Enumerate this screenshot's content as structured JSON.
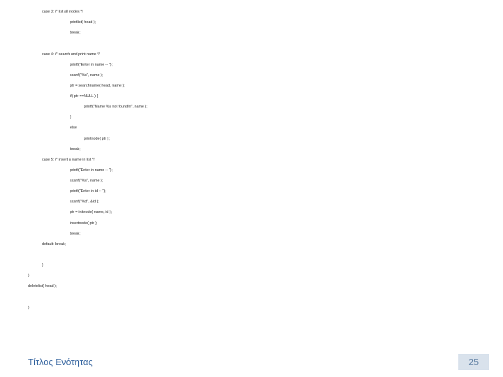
{
  "code": {
    "lines": [
      {
        "indent": 1,
        "text": "case 3: /* list all nodes */"
      },
      {
        "indent": 3,
        "text": "printlist( head );"
      },
      {
        "indent": 3,
        "text": "break;"
      },
      {
        "indent": 3,
        "text": ""
      },
      {
        "indent": 1,
        "text": "case 4: /* search and print name */"
      },
      {
        "indent": 3,
        "text": "printf(\"Enter in name -- \");"
      },
      {
        "indent": 3,
        "text": "scanf(\"%s\", name );"
      },
      {
        "indent": 3,
        "text": "ptr = searchname( head, name );"
      },
      {
        "indent": 3,
        "text": "if( ptr ==NULL ) {"
      },
      {
        "indent": 4,
        "text": "printf(\"Name %s not found\\n\", name );"
      },
      {
        "indent": 3,
        "text": "}"
      },
      {
        "indent": 3,
        "text": "else"
      },
      {
        "indent": 4,
        "text": "printnode( ptr );"
      },
      {
        "indent": 3,
        "text": "break;"
      },
      {
        "indent": 1,
        "text": "case 5: /* insert a name in list */"
      },
      {
        "indent": 3,
        "text": "printf(\"Enter in name -- \");"
      },
      {
        "indent": 3,
        "text": "scanf(\"%s\", name );"
      },
      {
        "indent": 3,
        "text": "printf(\"Enter in id -- \");"
      },
      {
        "indent": 3,
        "text": "scanf(\"%d\", &id );"
      },
      {
        "indent": 3,
        "text": "ptr = initnode( name, id );"
      },
      {
        "indent": 3,
        "text": "insertnode( ptr );"
      },
      {
        "indent": 3,
        "text": "break;"
      },
      {
        "indent": 1,
        "text": "default: break;"
      },
      {
        "indent": 1,
        "text": ""
      },
      {
        "indent": 1,
        "text": "}"
      },
      {
        "indent": 0,
        "text": "}"
      },
      {
        "indent": 0,
        "text": "deletelist( head );"
      },
      {
        "indent": 0,
        "text": ""
      },
      {
        "indent": 0,
        "text": "}"
      }
    ]
  },
  "footer": {
    "title": "Τίτλος Ενότητας",
    "page": "25"
  }
}
